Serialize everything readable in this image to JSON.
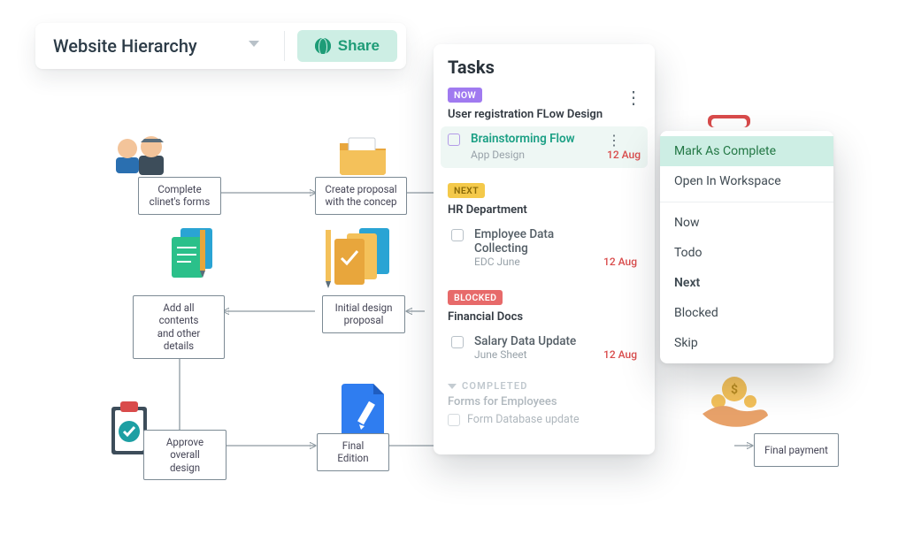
{
  "toolbar": {
    "dropdown_label": "Website Hierarchy",
    "share_label": "Share"
  },
  "nodes": {
    "clients_forms": "Complete\nclinet's forms",
    "create_proposal": "Create proposal\nwith the concep",
    "add_contents": "Add all contents\nand other details",
    "initial_design": "Initial design\nproposal",
    "approve": "Approve overall\ndesign",
    "final_edition": "Final Edition",
    "final_payment": "Final  payment"
  },
  "tasks": {
    "title": "Tasks",
    "sections": [
      {
        "badge": "NOW",
        "badge_kind": "now",
        "group": "User registration FLow Design",
        "item": {
          "name": "Brainstorming Flow",
          "sub": "App Design",
          "date": "12 Aug",
          "active": true
        }
      },
      {
        "badge": "NEXT",
        "badge_kind": "next",
        "group": "HR Department",
        "item": {
          "name": "Employee Data Collecting",
          "sub": "EDC June",
          "date": "12 Aug"
        }
      },
      {
        "badge": "BLOCKED",
        "badge_kind": "blocked",
        "group": "Financial Docs",
        "item": {
          "name": "Salary Data Update",
          "sub": "June Sheet",
          "date": "12 Aug"
        }
      }
    ],
    "completed": {
      "label": "COMPLETED",
      "group": "Forms for Employees",
      "item": "Form Database update"
    }
  },
  "ctx": {
    "mark_complete": "Mark As Complete",
    "open_workspace": "Open In Workspace",
    "now": "Now",
    "todo": "Todo",
    "next": "Next",
    "blocked": "Blocked",
    "skip": "Skip"
  }
}
